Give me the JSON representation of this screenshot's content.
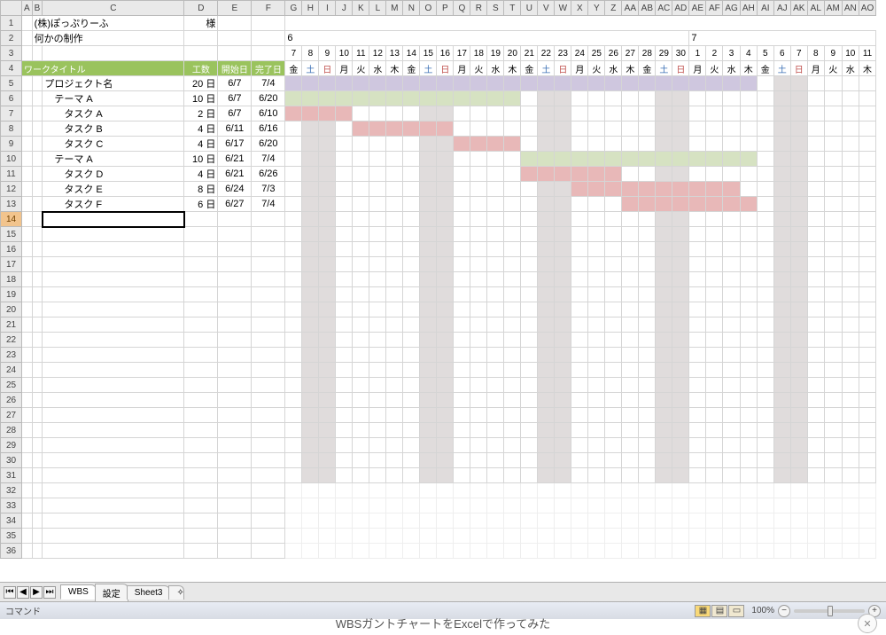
{
  "company": "(株)ぽっぷりーふ",
  "honor": "様",
  "project_label": "何かの制作",
  "headers": {
    "title": "ワークタイトル",
    "effort": "工数",
    "start": "開始日",
    "end": "完了日"
  },
  "rows": [
    {
      "n": 5,
      "a": "",
      "b": "プロジェクト名",
      "eff": "20 日",
      "s": "6/7",
      "e": "7/4"
    },
    {
      "n": 6,
      "a": "",
      "b": "　テーマ  A",
      "eff": "10 日",
      "s": "6/7",
      "e": "6/20"
    },
    {
      "n": 7,
      "a": "",
      "b": "　　タスク  A",
      "eff": "2 日",
      "s": "6/7",
      "e": "6/10"
    },
    {
      "n": 8,
      "a": "",
      "b": "　　タスク  B",
      "eff": "4 日",
      "s": "6/11",
      "e": "6/16"
    },
    {
      "n": 9,
      "a": "",
      "b": "　　タスク  C",
      "eff": "4 日",
      "s": "6/17",
      "e": "6/20"
    },
    {
      "n": 10,
      "a": "",
      "b": "　テーマ  A",
      "eff": "10 日",
      "s": "6/21",
      "e": "7/4"
    },
    {
      "n": 11,
      "a": "",
      "b": "　　タスク  D",
      "eff": "4 日",
      "s": "6/21",
      "e": "6/26"
    },
    {
      "n": 12,
      "a": "",
      "b": "　　タスク  E",
      "eff": "8 日",
      "s": "6/24",
      "e": "7/3"
    },
    {
      "n": 13,
      "a": "",
      "b": "　　タスク  F",
      "eff": "6 日",
      "s": "6/27",
      "e": "7/4"
    }
  ],
  "months": [
    "6",
    "7"
  ],
  "days": [
    7,
    8,
    9,
    10,
    11,
    12,
    13,
    14,
    15,
    16,
    17,
    18,
    19,
    20,
    21,
    22,
    23,
    24,
    25,
    26,
    27,
    28,
    29,
    30,
    1,
    2,
    3,
    4,
    5,
    6,
    7,
    8,
    9,
    10,
    11
  ],
  "weekdays": [
    "金",
    "土",
    "日",
    "月",
    "火",
    "水",
    "木",
    "金",
    "土",
    "日",
    "月",
    "火",
    "水",
    "木",
    "金",
    "土",
    "日",
    "月",
    "火",
    "水",
    "木",
    "金",
    "土",
    "日",
    "月",
    "火",
    "水",
    "木",
    "金",
    "土",
    "日",
    "月",
    "火",
    "水",
    "木"
  ],
  "weekend_cols": [
    1,
    2,
    8,
    9,
    15,
    16,
    22,
    23,
    29,
    30
  ],
  "bars": {
    "5": {
      "cls": "gp",
      "from": 0,
      "to": 27
    },
    "6": {
      "cls": "gg",
      "from": 0,
      "to": 13
    },
    "7": {
      "cls": "gr",
      "from": 0,
      "to": 3
    },
    "8": {
      "cls": "gr",
      "from": 4,
      "to": 9
    },
    "9": {
      "cls": "gr",
      "from": 10,
      "to": 13
    },
    "10": {
      "cls": "gg",
      "from": 14,
      "to": 27
    },
    "11": {
      "cls": "gr",
      "from": 14,
      "to": 19
    },
    "12": {
      "cls": "gr",
      "from": 17,
      "to": 26
    },
    "13": {
      "cls": "gr",
      "from": 20,
      "to": 27
    }
  },
  "tabs": [
    "WBS",
    "設定",
    "Sheet3"
  ],
  "status": "コマンド",
  "zoom": "100%",
  "caption": "WBSガントチャートをExcelで作ってみた",
  "collabels": [
    "A",
    "B",
    "C",
    "D",
    "E",
    "F",
    "G",
    "H",
    "I",
    "J",
    "K",
    "L",
    "M",
    "N",
    "O",
    "P",
    "Q",
    "R",
    "S",
    "T",
    "U",
    "V",
    "W",
    "X",
    "Y",
    "Z",
    "AA",
    "AB",
    "AC",
    "AD",
    "AE",
    "AF",
    "AG",
    "AH",
    "AI",
    "AJ",
    "AK",
    "AL",
    "AM",
    "AN",
    "AO"
  ]
}
